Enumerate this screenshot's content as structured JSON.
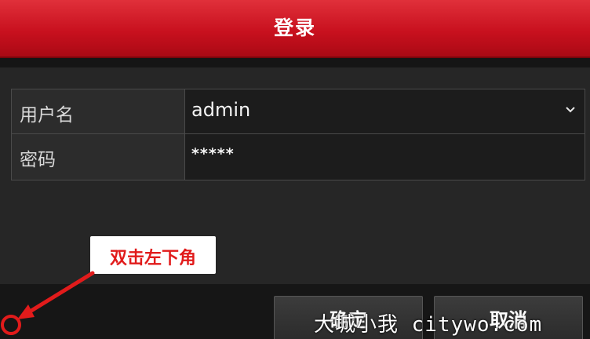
{
  "window": {
    "title": "登录"
  },
  "form": {
    "username_label": "用户名",
    "username_value": "admin",
    "password_label": "密码",
    "password_value": "*****"
  },
  "buttons": {
    "ok_label": "确定",
    "cancel_label": "取消"
  },
  "annotation": {
    "hint_text": "双击左下角",
    "arrow_color": "#e11b1b"
  },
  "watermark": {
    "text": "大城小我 citywo.com"
  },
  "colors": {
    "title_bar": "#c8101e",
    "background": "#262626",
    "field_background": "#1c1c1c"
  },
  "icons": {
    "dropdown": "chevron-down-icon",
    "hint_arrow": "arrow-icon",
    "corner_target": "circle-marker-icon"
  }
}
